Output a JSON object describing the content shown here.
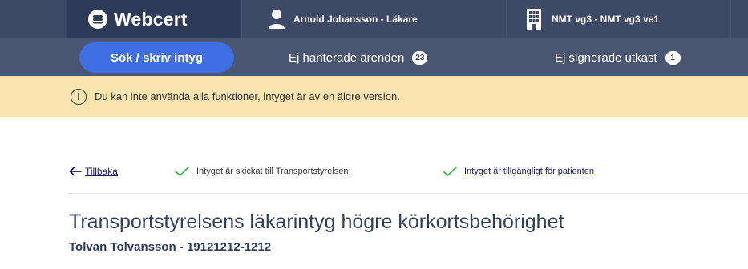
{
  "app": {
    "logo_text": "Webcert",
    "user_label": "Arnold Johansson - Läkare",
    "unit_label": "NMT vg3 - NMT vg3 ve1"
  },
  "nav": {
    "search_label": "Sök / skriv intyg",
    "unhandled_label": "Ej hanterade ärenden",
    "unhandled_count": "23",
    "unsigned_label": "Ej signerade utkast",
    "unsigned_count": "1"
  },
  "banner": {
    "icon": "!",
    "text": "Du kan inte använda alla funktioner, intyget är av en äldre version."
  },
  "status": {
    "back_label": "Tillbaka",
    "sent_text": "Intyget är skickat till Transportstyrelsen",
    "available_text": "Intyget är tillgängligt för patienten"
  },
  "certificate": {
    "title": "Transportstyrelsens läkarintyg högre körkortsbehörighet",
    "patient": "Tolvan Tolvansson - 19121212-1212"
  },
  "colors": {
    "header_dark": "#2d3a58",
    "header": "#3e4965",
    "accent": "#3f6fe2",
    "banner": "#f9e4b0",
    "success": "#3ab54a"
  },
  "icons": {
    "logo": "webcert-logo-icon",
    "user": "user-icon",
    "unit": "building-icon",
    "banner": "info-icon",
    "back": "arrow-left-icon",
    "check": "check-icon"
  }
}
